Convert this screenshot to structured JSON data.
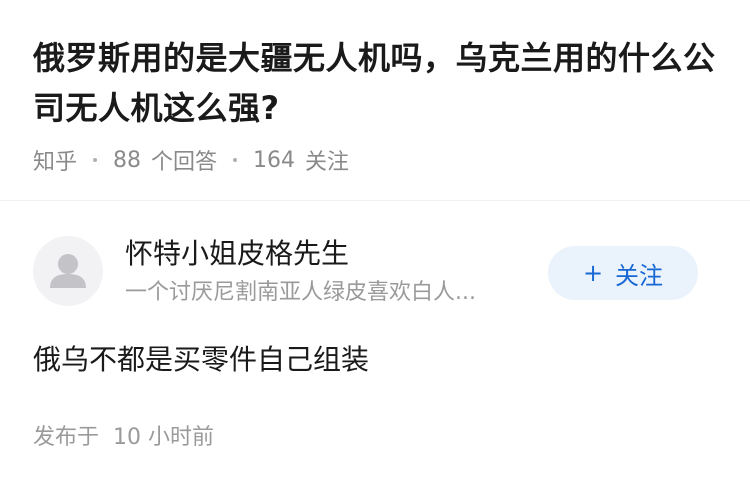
{
  "question": {
    "title": "俄罗斯用的是大疆无人机吗，乌克兰用的什么公司无人机这么强?",
    "source": "知乎",
    "answers_count": "88",
    "answers_label": "个回答",
    "followers_count": "164",
    "followers_label": "关注"
  },
  "answer": {
    "author": {
      "name": "怀特小姐皮格先生",
      "bio": "一个讨厌尼割南亚人绿皮喜欢白人...",
      "avatar_icon": "user-avatar-icon"
    },
    "follow_button": {
      "icon": "plus-icon",
      "label": "关注"
    },
    "content": "俄乌不都是买零件自己组装",
    "published_label": "发布于",
    "published_time": "10 小时前"
  },
  "colors": {
    "title_text": "#1a1a1a",
    "meta_text": "#8a8a8a",
    "follow_accent": "#1768d4",
    "follow_bg": "#eaf2fb",
    "divider": "#f0f0f0"
  }
}
